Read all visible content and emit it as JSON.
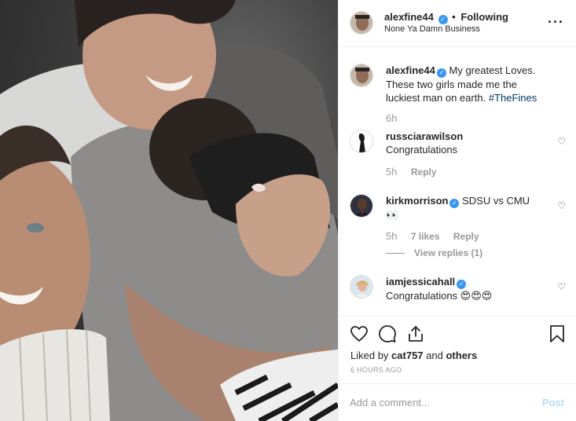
{
  "post": {
    "author": "alexfine44",
    "follow_separator": "•",
    "follow_status": "Following",
    "location": "None Ya Damn Business",
    "more_icon": "more-options-icon"
  },
  "caption": {
    "username": "alexfine44",
    "text": "My greatest Loves. These two girls made me the luckiest man on earth.",
    "hashtag": "#TheFines",
    "time": "6h"
  },
  "comments": [
    {
      "username": "russciarawilson",
      "verified": false,
      "text": "Congratulations",
      "time": "5h",
      "likes": "",
      "reply": "Reply"
    },
    {
      "username": "kirkmorrison",
      "verified": true,
      "text": "SDSU vs CMU",
      "extra": "👀",
      "time": "5h",
      "likes": "7 likes",
      "reply": "Reply",
      "view_replies": "View replies (1)"
    },
    {
      "username": "iamjessicahall",
      "verified": true,
      "text": "Congratulations 😍😍😍",
      "time": "",
      "likes": "",
      "reply": ""
    }
  ],
  "actions": {
    "liked_by_prefix": "Liked by",
    "liked_by_user": "cat757",
    "liked_by_and": "and",
    "liked_by_others": "others",
    "timestamp": "6 HOURS AGO"
  },
  "add_comment": {
    "placeholder": "Add a comment...",
    "post_label": "Post"
  },
  "colors": {
    "link_blue": "#3897f0",
    "hashtag": "#003569",
    "muted": "#999999",
    "post_disabled": "#b2dffc"
  }
}
